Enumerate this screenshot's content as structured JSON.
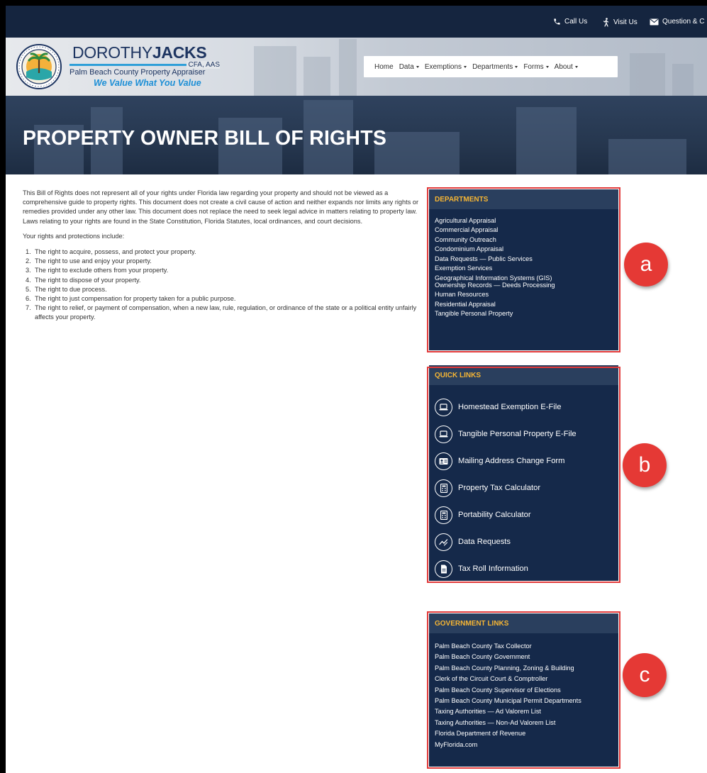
{
  "topbar": {
    "call_label": "Call Us",
    "visit_label": "Visit Us",
    "question_label": "Question & C"
  },
  "logo": {
    "name_first": "DOROTHY",
    "name_last": "JACKS",
    "credentials": "CFA, AAS",
    "subtitle": "Palm Beach County Property Appraiser",
    "tagline": "We Value What You Value"
  },
  "nav": {
    "items": [
      "Home",
      "Data",
      "Exemptions",
      "Departments",
      "Forms",
      "About"
    ]
  },
  "hero": {
    "title": "PROPERTY OWNER BILL OF RIGHTS"
  },
  "content": {
    "intro": "This Bill of Rights does not represent all of your rights under Florida law regarding your property and should not be viewed as a comprehensive guide to property rights. This document does not create a civil cause of action and neither expands nor limits any rights or remedies provided under any other law. This document does not replace the need to seek legal advice in matters relating to property law. Laws relating to your rights are found in the State Constitution, Florida Statutes, local ordinances, and court decisions.",
    "rights_heading": "Your rights and protections include:",
    "rights": [
      {
        "num": "1.",
        "text": "The right to acquire, possess, and protect your property."
      },
      {
        "num": "2.",
        "text": "The right to use and enjoy your property."
      },
      {
        "num": "3.",
        "text": "The right to exclude others from your property."
      },
      {
        "num": "4.",
        "text": "The right to dispose of your property."
      },
      {
        "num": "5.",
        "text": "The right to due process."
      },
      {
        "num": "6.",
        "text": "The right to just compensation for property taken for a public purpose."
      },
      {
        "num": "7.",
        "text": "The right to relief, or payment of compensation, when a new law, rule, regulation, or ordinance of the state or a political entity unfairly affects your property."
      }
    ]
  },
  "departments": {
    "title": "DEPARTMENTS",
    "links": [
      "Agricultural Appraisal",
      "Commercial Appraisal",
      "Community Outreach",
      "Condominium Appraisal",
      "Data Requests — Public Services",
      "Exemption Services",
      "Geographical Information Systems (GIS)",
      "Ownership Records — Deeds Processing",
      "Human Resources",
      "Residential Appraisal",
      "Tangible Personal Property"
    ]
  },
  "quick_links": {
    "title": "QUICK LINKS",
    "items": [
      {
        "label": "Homestead Exemption E-File",
        "icon": "laptop-icon"
      },
      {
        "label": "Tangible Personal Property E-File",
        "icon": "laptop-icon"
      },
      {
        "label": "Mailing Address Change Form",
        "icon": "address-card-icon"
      },
      {
        "label": "Property Tax Calculator",
        "icon": "calculator-icon"
      },
      {
        "label": "Portability Calculator",
        "icon": "calculator-icon"
      },
      {
        "label": "Data Requests",
        "icon": "chart-icon"
      },
      {
        "label": "Tax Roll Information",
        "icon": "document-icon"
      }
    ]
  },
  "government_links": {
    "title": "GOVERNMENT LINKS",
    "links": [
      "Palm Beach County Tax Collector",
      "Palm Beach County Government",
      "Palm Beach County Planning, Zoning & Building",
      "Clerk of the Circuit Court & Comptroller",
      "Palm Beach County Supervisor of Elections",
      "Palm Beach County Municipal Permit Departments",
      "Taxing Authorities — Ad Valorem List",
      "Taxing Authorities — Non-Ad Valorem List",
      "Florida Department of Revenue",
      "MyFlorida.com"
    ]
  },
  "annotations": {
    "a": "a",
    "b": "b",
    "c": "c"
  },
  "colors": {
    "topbar": "#15253f",
    "panel": "#15294a",
    "panel_header_text": "#f5b534",
    "annotation_frame": "#e23a3a",
    "annotation_badge": "#e53935"
  }
}
